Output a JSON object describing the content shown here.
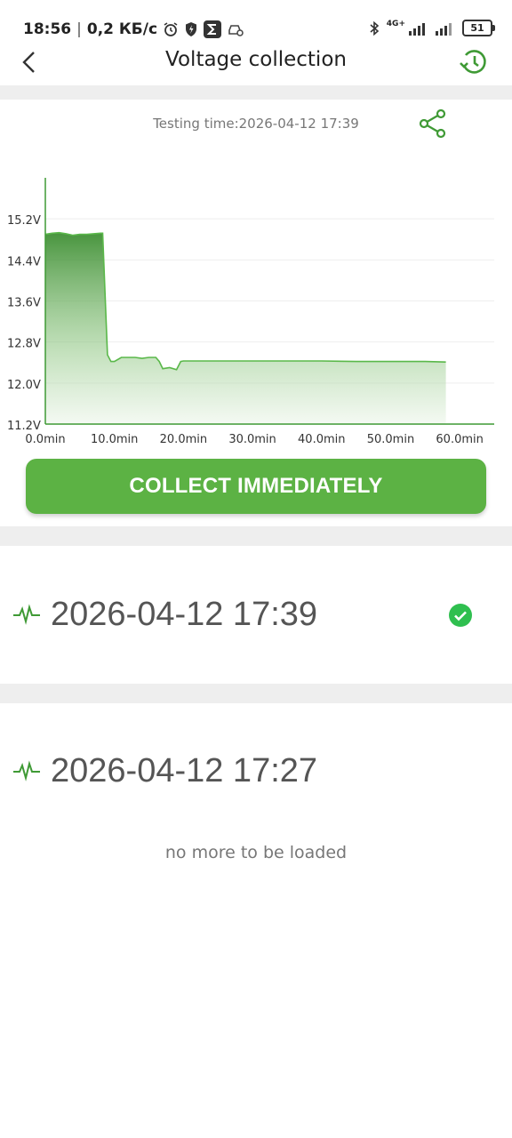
{
  "status_bar": {
    "time": "18:56",
    "net_speed": "0,2 КБ/с",
    "network": "4G+",
    "battery": "51"
  },
  "header": {
    "title": "Voltage collection"
  },
  "test": {
    "testing_time": "Testing time:2026-04-12 17:39"
  },
  "chart_data": {
    "type": "area",
    "x_unit": "min",
    "y_unit": "V",
    "x_ticks": [
      "0.0min",
      "10.0min",
      "20.0min",
      "30.0min",
      "40.0min",
      "50.0min",
      "60.0min"
    ],
    "y_ticks": [
      "15.2V",
      "14.4V",
      "13.6V",
      "12.8V",
      "12.0V",
      "11.2V"
    ],
    "xlim": [
      0,
      65
    ],
    "ylim": [
      11.2,
      16.0
    ],
    "grid": true,
    "color": "#3f9a35",
    "series": [
      {
        "x": [
          0,
          1,
          2,
          3,
          4,
          5,
          6,
          7,
          8,
          8.3,
          9,
          9.5,
          10,
          11,
          12,
          13,
          14,
          15,
          16,
          16.5,
          17,
          18,
          19,
          19.6,
          20,
          22,
          25,
          30,
          35,
          40,
          45,
          50,
          55,
          58
        ],
        "y": [
          14.9,
          14.92,
          14.93,
          14.91,
          14.88,
          14.9,
          14.9,
          14.91,
          14.92,
          14.92,
          12.55,
          12.42,
          12.42,
          12.5,
          12.5,
          12.5,
          12.48,
          12.5,
          12.5,
          12.42,
          12.28,
          12.3,
          12.26,
          12.42,
          12.43,
          12.43,
          12.43,
          12.43,
          12.43,
          12.43,
          12.42,
          12.42,
          12.42,
          12.41
        ]
      }
    ]
  },
  "actions": {
    "collect_label": "COLLECT IMMEDIATELY"
  },
  "records": [
    {
      "time": "2026-04-12 17:39",
      "selected": true
    },
    {
      "time": "2026-04-12 17:27",
      "selected": false
    }
  ],
  "footer": {
    "no_more": "no more to be loaded"
  }
}
